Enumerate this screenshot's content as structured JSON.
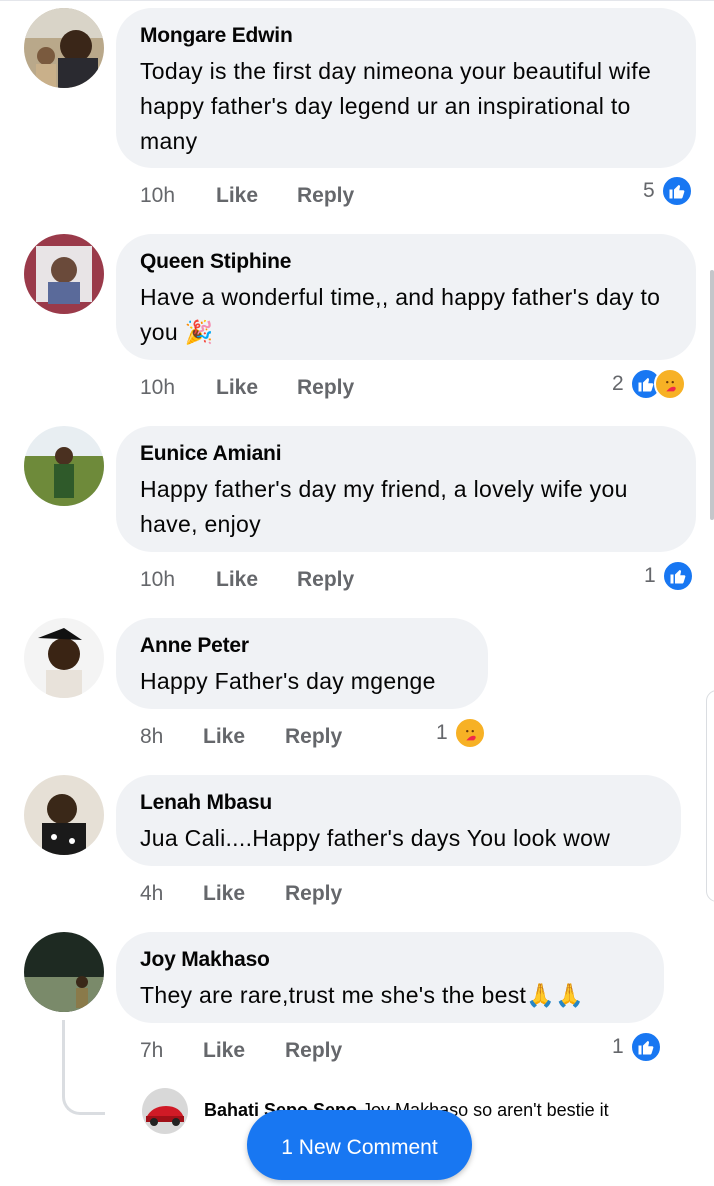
{
  "comments": [
    {
      "author": "Mongare Edwin",
      "text": "Today is the first day nimeona your beautiful wife happy father's day legend ur an inspirational to many",
      "time": "10h",
      "like": "Like",
      "reply": "Reply",
      "reaction_count": "5",
      "reactions": [
        "like-icon"
      ]
    },
    {
      "author": "Queen Stiphine",
      "text": "Have a wonderful time,, and happy father's day to you 🎉",
      "time": "10h",
      "like": "Like",
      "reply": "Reply",
      "reaction_count": "2",
      "reactions": [
        "like-icon",
        "care-icon"
      ]
    },
    {
      "author": "Eunice Amiani",
      "text": "Happy father's day my friend, a lovely wife you have, enjoy",
      "time": "10h",
      "like": "Like",
      "reply": "Reply",
      "reaction_count": "1",
      "reactions": [
        "like-icon"
      ]
    },
    {
      "author": "Anne Peter",
      "text": "Happy Father's day mgenge",
      "time": "8h",
      "like": "Like",
      "reply": "Reply",
      "reaction_count": "1",
      "reactions": [
        "care-icon"
      ]
    },
    {
      "author": "Lenah Mbasu",
      "text": "Jua Cali....Happy father's days  You look wow",
      "time": "4h",
      "like": "Like",
      "reply": "Reply",
      "reaction_count": "",
      "reactions": []
    },
    {
      "author": "Joy Makhaso",
      "text": "They are rare,trust me she's the best🙏🙏",
      "time": "7h",
      "like": "Like",
      "reply": "Reply",
      "reaction_count": "1",
      "reactions": [
        "like-icon"
      ]
    }
  ],
  "reply_preview": {
    "author": "Bahati Sepo Sepo",
    "text": "Joy Makhaso so aren't bestie it"
  },
  "new_comment_button": "1 New Comment",
  "colors": {
    "accent": "#1877f2",
    "bubble": "#f0f2f5",
    "meta": "#65676b",
    "care": "#f7b125"
  }
}
